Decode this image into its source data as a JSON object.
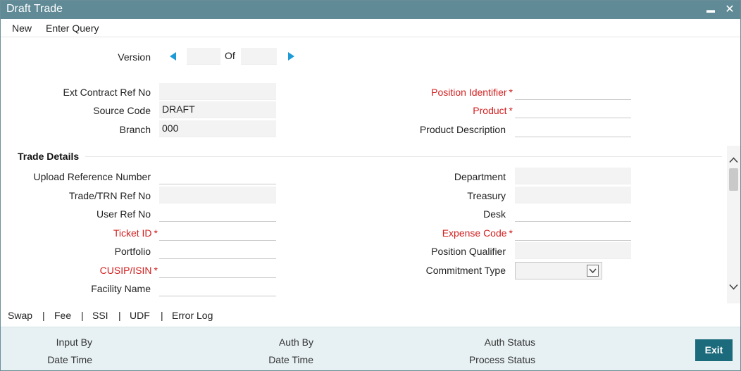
{
  "window": {
    "title": "Draft Trade",
    "minimize_glyph": "▬",
    "close_glyph": "✕"
  },
  "menu": {
    "new_label": "New",
    "enter_query_label": "Enter Query"
  },
  "version": {
    "label": "Version",
    "current": "",
    "of_label": "Of",
    "total": ""
  },
  "header_left": {
    "ext_contract_ref_no": {
      "label": "Ext Contract Ref No",
      "value": ""
    },
    "source_code": {
      "label": "Source Code",
      "value": "DRAFT"
    },
    "branch": {
      "label": "Branch",
      "value": "000"
    }
  },
  "header_right": {
    "position_identifier": {
      "label": "Position Identifier",
      "value": "",
      "required": true
    },
    "product": {
      "label": "Product",
      "value": "",
      "required": true
    },
    "product_description": {
      "label": "Product Description",
      "value": ""
    }
  },
  "trade_details": {
    "section_title": "Trade Details",
    "left": {
      "upload_reference_number": {
        "label": "Upload Reference Number",
        "value": ""
      },
      "trade_trn_ref_no": {
        "label": "Trade/TRN Ref No",
        "value": ""
      },
      "user_ref_no": {
        "label": "User Ref No",
        "value": ""
      },
      "ticket_id": {
        "label": "Ticket ID",
        "value": "",
        "required": true
      },
      "portfolio": {
        "label": "Portfolio",
        "value": ""
      },
      "cusip_isin": {
        "label": "CUSIP/ISIN",
        "value": "",
        "required": true
      },
      "facility_name": {
        "label": "Facility Name",
        "value": ""
      }
    },
    "right": {
      "department": {
        "label": "Department",
        "value": ""
      },
      "treasury": {
        "label": "Treasury",
        "value": ""
      },
      "desk": {
        "label": "Desk",
        "value": ""
      },
      "expense_code": {
        "label": "Expense Code",
        "value": "",
        "required": true
      },
      "position_qualifier": {
        "label": "Position Qualifier",
        "value": ""
      },
      "commitment_type": {
        "label": "Commitment Type",
        "value": ""
      }
    },
    "required_mark": "*"
  },
  "tabs": {
    "swap": "Swap",
    "fee": "Fee",
    "ssi": "SSI",
    "udf": "UDF",
    "error_log": "Error Log",
    "separator": "|"
  },
  "footer": {
    "input_by": "Input By",
    "date_time_1": "Date Time",
    "auth_by": "Auth By",
    "date_time_2": "Date Time",
    "auth_status": "Auth Status",
    "process_status": "Process Status",
    "exit_label": "Exit"
  },
  "colors": {
    "titlebar": "#5f8a96",
    "required": "#d32020",
    "accent_arrow": "#1e9ad6",
    "exit_button": "#1c6b7c",
    "footer_bg": "#e7f1f3"
  },
  "icons": {
    "prev": "triangle-left-icon",
    "next": "triangle-right-icon",
    "dropdown": "chevron-down-icon",
    "scroll_up": "chevron-up-icon",
    "scroll_down": "chevron-down-icon"
  }
}
